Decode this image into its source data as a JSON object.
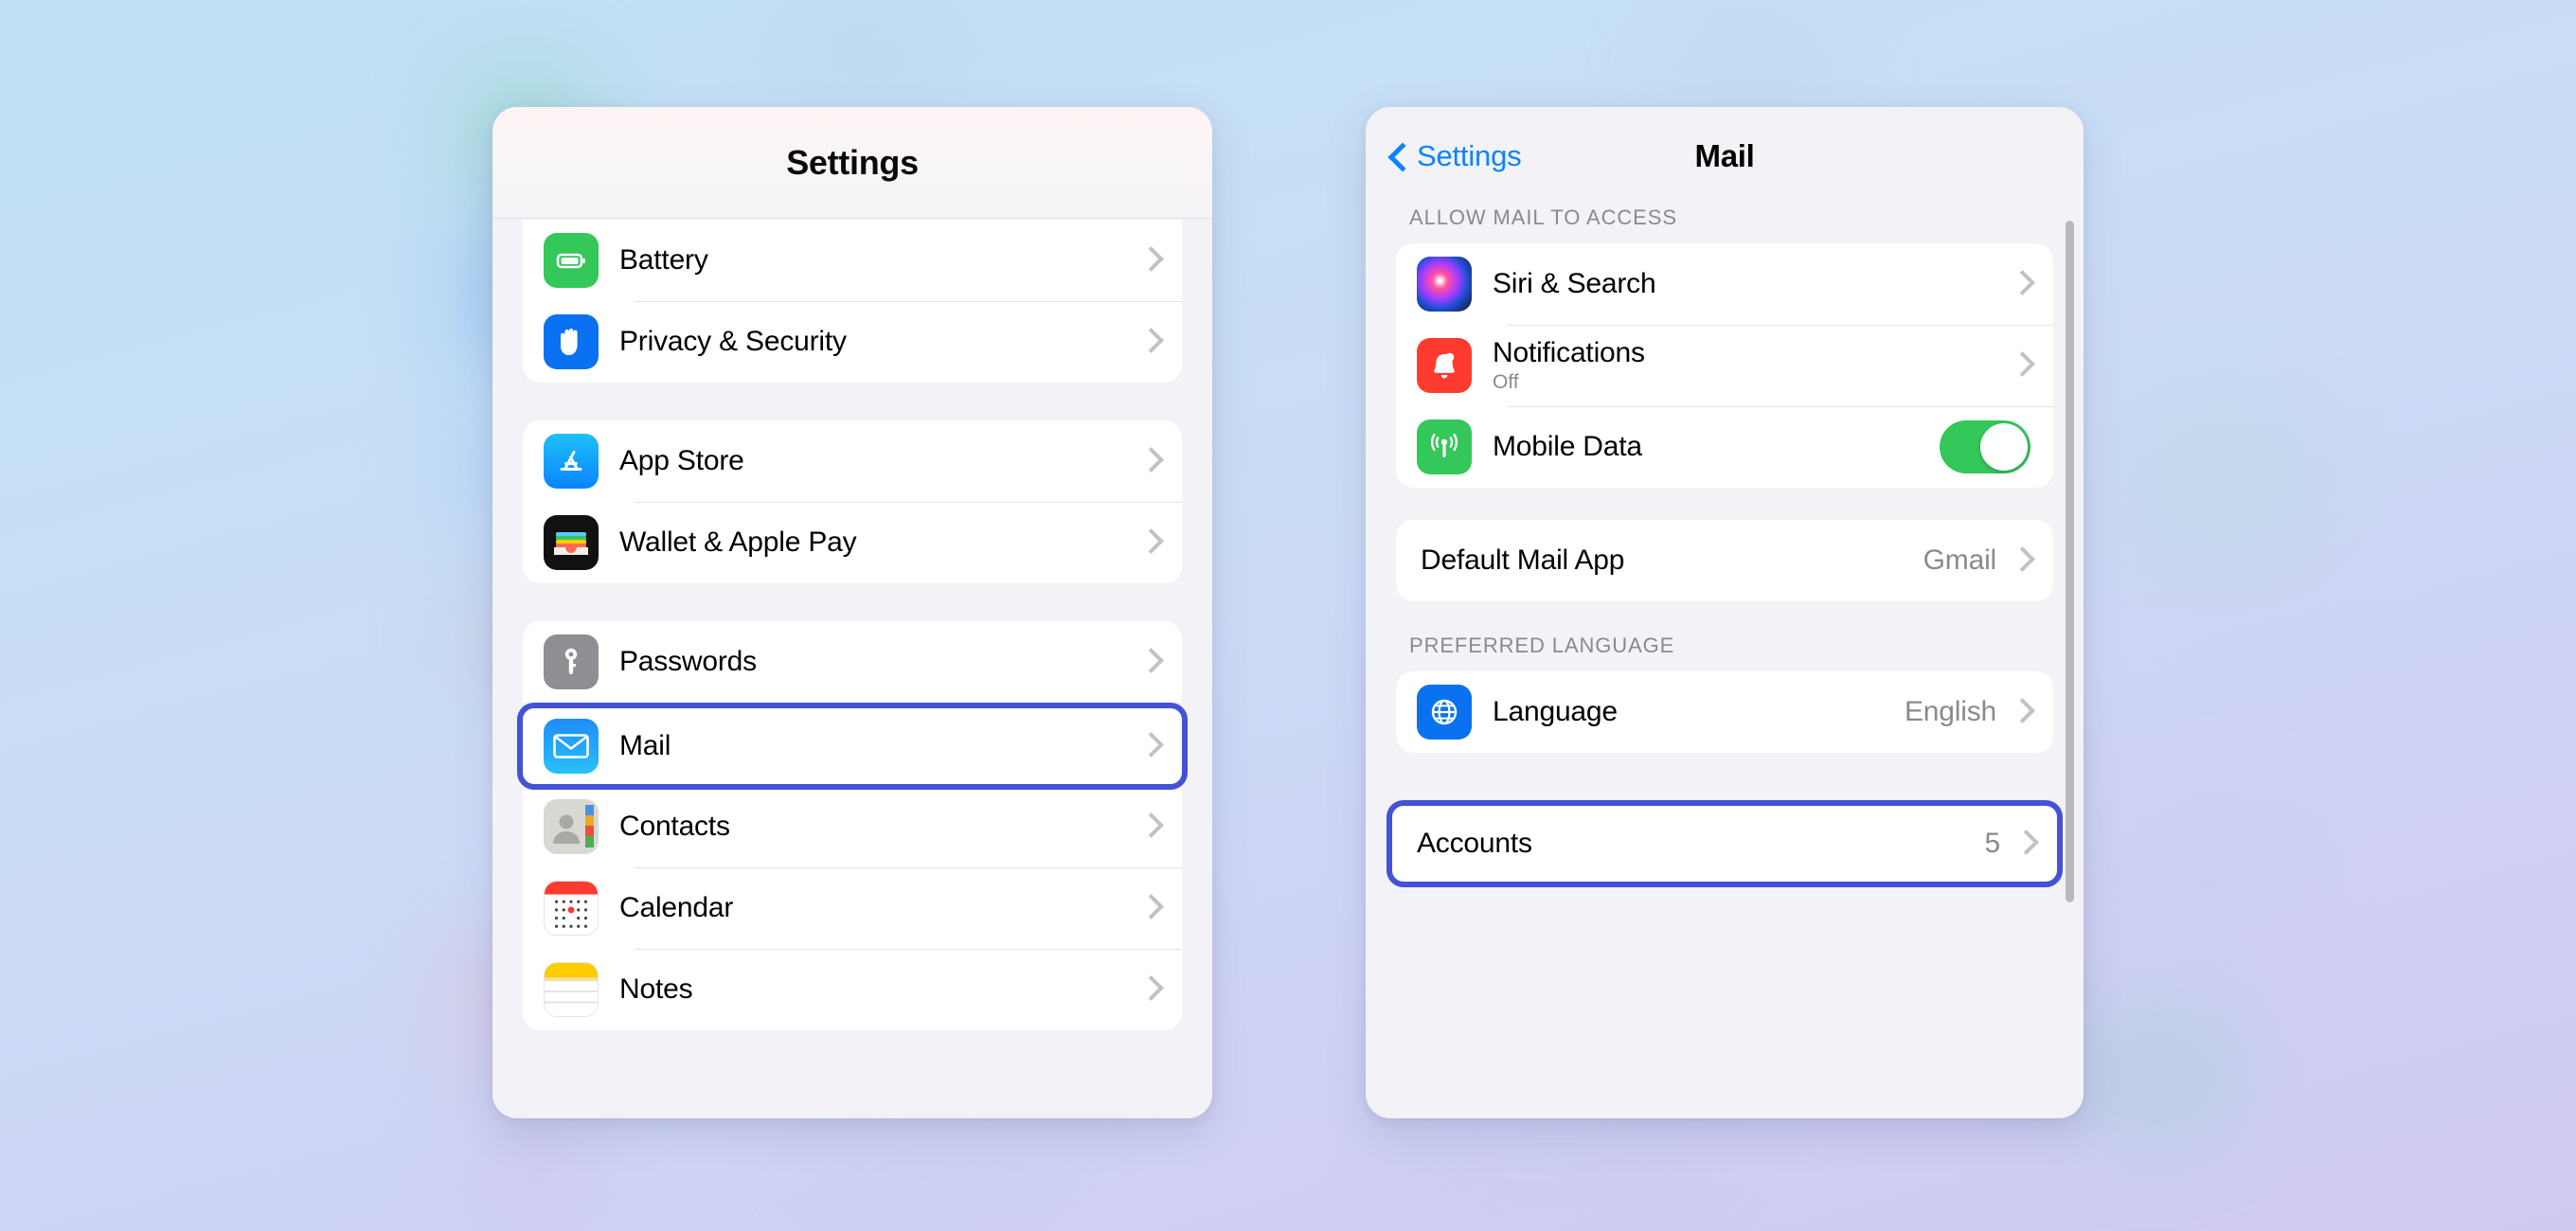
{
  "background": {
    "gradient_from": "#bfe0f5",
    "gradient_to": "#cfc9f2"
  },
  "highlight_color": "#4352d6",
  "accent_color": "#0a84ff",
  "left_panel": {
    "title": "Settings",
    "groups": [
      {
        "rows": [
          {
            "label": "Battery",
            "icon": "battery-icon",
            "accessory": "chevron"
          },
          {
            "label": "Privacy & Security",
            "icon": "hand-icon",
            "accessory": "chevron"
          }
        ]
      },
      {
        "rows": [
          {
            "label": "App Store",
            "icon": "app-store-icon",
            "accessory": "chevron"
          },
          {
            "label": "Wallet & Apple Pay",
            "icon": "wallet-icon",
            "accessory": "chevron"
          }
        ]
      },
      {
        "rows": [
          {
            "label": "Passwords",
            "icon": "key-icon",
            "accessory": "chevron"
          }
        ]
      },
      {
        "highlighted": true,
        "rows": [
          {
            "label": "Mail",
            "icon": "envelope-icon",
            "accessory": "chevron"
          }
        ]
      },
      {
        "rows": [
          {
            "label": "Contacts",
            "icon": "contacts-icon",
            "accessory": "chevron"
          },
          {
            "label": "Calendar",
            "icon": "calendar-icon",
            "accessory": "chevron"
          },
          {
            "label": "Notes",
            "icon": "notes-icon",
            "accessory": "chevron"
          }
        ]
      }
    ]
  },
  "right_panel": {
    "back_label": "Settings",
    "title": "Mail",
    "sections": [
      {
        "header": "ALLOW MAIL TO ACCESS",
        "rows": [
          {
            "label": "Siri & Search",
            "icon": "siri-icon",
            "accessory": "chevron"
          },
          {
            "label": "Notifications",
            "sublabel": "Off",
            "icon": "notifications-icon",
            "accessory": "chevron"
          },
          {
            "label": "Mobile Data",
            "icon": "cellular-icon",
            "accessory": "toggle",
            "toggle_on": true
          }
        ]
      },
      {
        "header": "",
        "rows": [
          {
            "label": "Default Mail App",
            "value": "Gmail",
            "accessory": "chevron"
          }
        ]
      },
      {
        "header": "PREFERRED LANGUAGE",
        "rows": [
          {
            "label": "Language",
            "value": "English",
            "icon": "globe-icon",
            "accessory": "chevron"
          }
        ]
      },
      {
        "header": "",
        "highlighted": true,
        "rows": [
          {
            "label": "Accounts",
            "value": "5",
            "accessory": "chevron"
          }
        ]
      }
    ]
  }
}
